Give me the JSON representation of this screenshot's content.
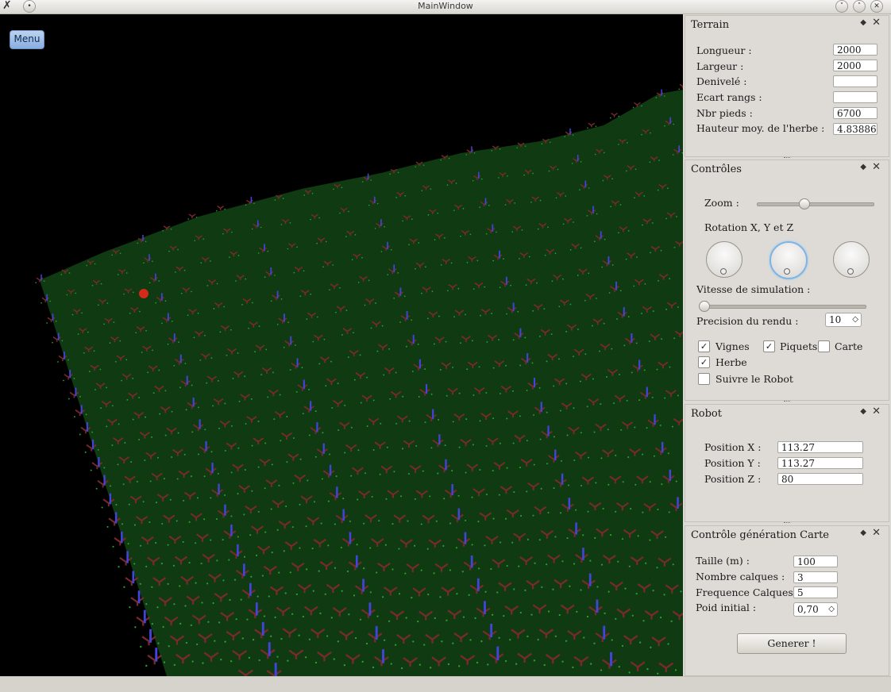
{
  "window": {
    "title": "MainWindow"
  },
  "viewport": {
    "menu_label": "Menu"
  },
  "terrain": {
    "title": "Terrain",
    "fields": [
      {
        "label": "Longueur :",
        "value": "2000"
      },
      {
        "label": "Largeur :",
        "value": "2000"
      },
      {
        "label": "Denivelé :",
        "value": ""
      },
      {
        "label": "Ecart rangs :",
        "value": ""
      },
      {
        "label": "Nbr pieds :",
        "value": "6700"
      },
      {
        "label": "Hauteur moy. de l'herbe :",
        "value": "4.83886"
      }
    ]
  },
  "controles": {
    "title": "Contrôles",
    "zoom_label": "Zoom :",
    "zoom_level": 0.4,
    "rotation_label": "Rotation X,  Y et  Z",
    "vitesse_label": "Vitesse de simulation :",
    "vitesse_level": 0.0,
    "precision_label": "Precision du rendu :",
    "precision_value": "10",
    "checkboxes": [
      {
        "label": "Vignes",
        "checked": true
      },
      {
        "label": "Piquets",
        "checked": true
      },
      {
        "label": "Carte",
        "checked": false
      },
      {
        "label": "Herbe",
        "checked": true
      },
      {
        "label": "Suivre le Robot",
        "checked": false
      }
    ]
  },
  "robot": {
    "title": "Robot",
    "fields": [
      {
        "label": "Position X :",
        "value": "113.27"
      },
      {
        "label": "Position Y :",
        "value": "113.27"
      },
      {
        "label": "Position Z :",
        "value": "80"
      }
    ]
  },
  "carte": {
    "title": "Contrôle génération Carte",
    "fields": [
      {
        "label": "Taille (m) :",
        "value": "100"
      },
      {
        "label": "Nombre calques :",
        "value": "3"
      },
      {
        "label": "Frequence Calques :",
        "value": "5"
      }
    ],
    "poid_label": "Poid initial :",
    "poid_value": "0,70",
    "generate_label": "Generer !"
  },
  "colors": {
    "grass": "#2f9e2f",
    "vine": "#7a2a2a",
    "stake": "#4444dd",
    "robot": "#d42a1a"
  },
  "icons": {
    "float": "◆",
    "close": "✕",
    "check": "✓",
    "spin": "◇"
  }
}
